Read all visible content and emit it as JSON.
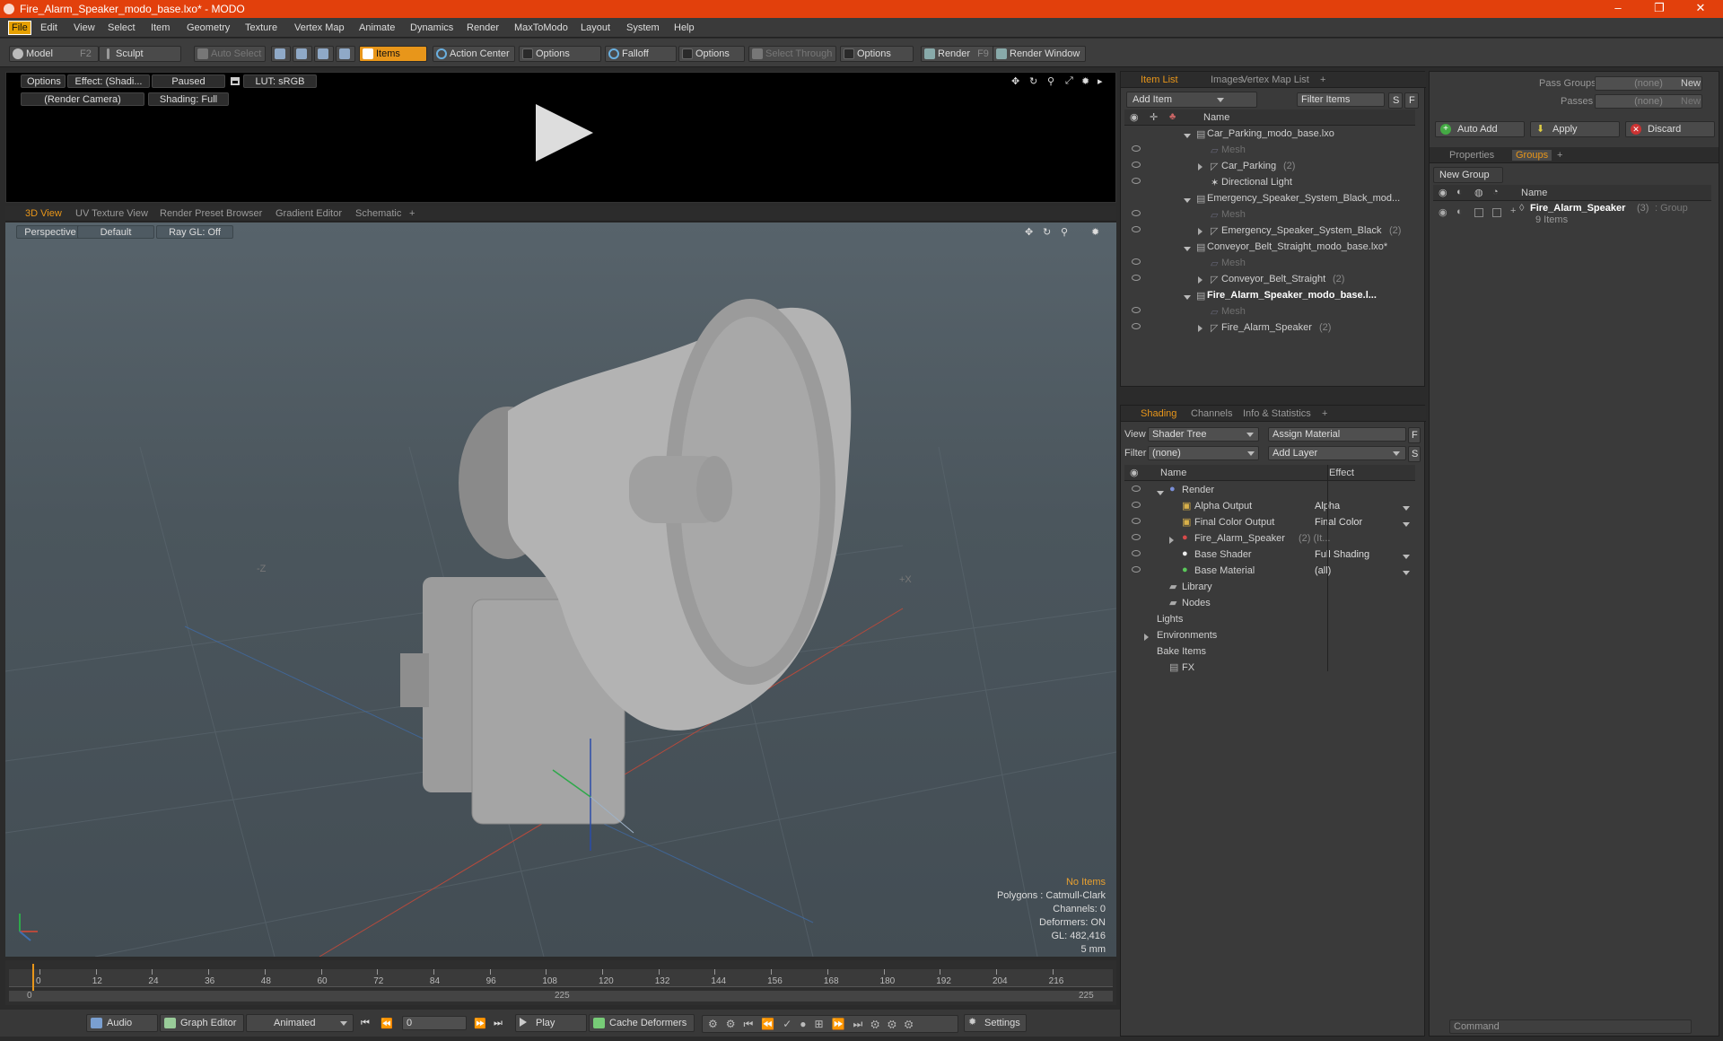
{
  "window": {
    "title": "Fire_Alarm_Speaker_modo_base.lxo* - MODO",
    "minimize": "–",
    "restore": "❐",
    "close": "✕"
  },
  "menu": [
    "File",
    "Edit",
    "View",
    "Select",
    "Item",
    "Geometry",
    "Texture",
    "Vertex Map",
    "Animate",
    "Dynamics",
    "Render",
    "MaxToModo",
    "Layout",
    "System",
    "Help"
  ],
  "toolbar": {
    "model": "Model",
    "model_key": "F2",
    "sculpt": "Sculpt",
    "auto_select": "Auto Select",
    "items": "Items",
    "action_center": "Action Center",
    "options1": "Options",
    "falloff": "Falloff",
    "options2": "Options",
    "select_through": "Select Through",
    "options3": "Options",
    "render": "Render",
    "render_key": "F9",
    "render_window": "Render Window"
  },
  "render_panel": {
    "options": "Options",
    "effect": "Effect: (Shadi...",
    "paused": "Paused",
    "lut": "LUT: sRGB",
    "camera": "(Render Camera)",
    "shading": "Shading: Full"
  },
  "view_tabs": [
    "3D View",
    "UV Texture View",
    "Render Preset Browser",
    "Gradient Editor",
    "Schematic",
    "+"
  ],
  "viewport": {
    "perspective": "Perspective",
    "default": "Default",
    "raygl": "Ray GL: Off",
    "axis_z": "-Z",
    "axis_x": "+X",
    "info": {
      "no_items": "No Items",
      "polygons": "Polygons : Catmull-Clark",
      "channels": "Channels: 0",
      "deformers": "Deformers: ON",
      "gl": "GL: 482,416",
      "scale": "5 mm"
    }
  },
  "timeline": {
    "ticks": [
      "0",
      "12",
      "24",
      "36",
      "48",
      "60",
      "72",
      "84",
      "96",
      "108",
      "120",
      "132",
      "144",
      "156",
      "168",
      "180",
      "192",
      "204",
      "216"
    ],
    "start": "0",
    "mid": "225",
    "end": "225"
  },
  "bottombar": {
    "audio": "Audio",
    "graph_editor": "Graph Editor",
    "animated": "Animated",
    "frame": "0",
    "play": "Play",
    "cache": "Cache Deformers",
    "settings": "Settings"
  },
  "item_list": {
    "tabs": [
      "Item List",
      "Images",
      "Vertex Map List",
      "+"
    ],
    "add_item": "Add Item",
    "filter": "Filter Items",
    "s": "S",
    "f": "F",
    "name_header": "Name",
    "rows": [
      {
        "label": "Car_Parking_modo_base.lxo",
        "count": "",
        "style": "scene"
      },
      {
        "label": "Mesh",
        "count": "",
        "style": "mesh"
      },
      {
        "label": "Car_Parking",
        "count": "(2)",
        "style": "grp"
      },
      {
        "label": "Directional Light",
        "count": "",
        "style": "light"
      },
      {
        "label": "Emergency_Speaker_System_Black_mod...",
        "count": "",
        "style": "scene"
      },
      {
        "label": "Mesh",
        "count": "",
        "style": "mesh"
      },
      {
        "label": "Emergency_Speaker_System_Black",
        "count": "(2)",
        "style": "grp"
      },
      {
        "label": "Conveyor_Belt_Straight_modo_base.lxo*",
        "count": "",
        "style": "scene"
      },
      {
        "label": "Mesh",
        "count": "",
        "style": "mesh"
      },
      {
        "label": "Conveyor_Belt_Straight",
        "count": "(2)",
        "style": "grp"
      },
      {
        "label": "Fire_Alarm_Speaker_modo_base.l...",
        "count": "",
        "style": "scene-bold"
      },
      {
        "label": "Mesh",
        "count": "",
        "style": "mesh"
      },
      {
        "label": "Fire_Alarm_Speaker",
        "count": "(2)",
        "style": "grp"
      }
    ]
  },
  "shading": {
    "tabs": [
      "Shading",
      "Channels",
      "Info & Statistics",
      "+"
    ],
    "view_label": "View",
    "view_value": "Shader Tree",
    "assign": "Assign Material",
    "f": "F",
    "filter_label": "Filter",
    "filter_value": "(none)",
    "add_layer": "Add Layer",
    "s": "S",
    "name_header": "Name",
    "effect_header": "Effect",
    "rows": [
      {
        "label": "Render",
        "count": "",
        "effect": "",
        "eye": true,
        "indent": 1
      },
      {
        "label": "Alpha Output",
        "count": "",
        "effect": "Alpha",
        "eye": true,
        "indent": 2
      },
      {
        "label": "Final Color Output",
        "count": "",
        "effect": "Final Color",
        "eye": true,
        "indent": 2
      },
      {
        "label": "Fire_Alarm_Speaker",
        "count": "(2) (It...",
        "effect": "",
        "eye": true,
        "indent": 2
      },
      {
        "label": "Base Shader",
        "count": "",
        "effect": "Full Shading",
        "eye": true,
        "indent": 2
      },
      {
        "label": "Base Material",
        "count": "",
        "effect": "(all)",
        "eye": true,
        "indent": 2
      },
      {
        "label": "Library",
        "count": "",
        "effect": "",
        "eye": false,
        "indent": 1
      },
      {
        "label": "Nodes",
        "count": "",
        "effect": "",
        "eye": false,
        "indent": 1
      },
      {
        "label": "Lights",
        "count": "",
        "effect": "",
        "eye": false,
        "indent": 0
      },
      {
        "label": "Environments",
        "count": "",
        "effect": "",
        "eye": false,
        "indent": 0
      },
      {
        "label": "Bake Items",
        "count": "",
        "effect": "",
        "eye": false,
        "indent": 0
      },
      {
        "label": "FX",
        "count": "",
        "effect": "",
        "eye": false,
        "indent": 1
      }
    ]
  },
  "groups_panel": {
    "pass_groups": "Pass Groups",
    "pass_groups_value": "(none)",
    "new1": "New",
    "passes": "Passes",
    "passes_value": "(none)",
    "new2": "New",
    "auto_add": "Auto Add",
    "apply": "Apply",
    "discard": "Discard",
    "tabs": [
      "Properties",
      "Groups",
      "+"
    ],
    "new_group": "New Group",
    "name_header": "Name",
    "group_name": "Fire_Alarm_Speaker",
    "group_count": "(3)",
    "group_type": ": Group",
    "group_items": "9 Items",
    "command_placeholder": "Command"
  }
}
